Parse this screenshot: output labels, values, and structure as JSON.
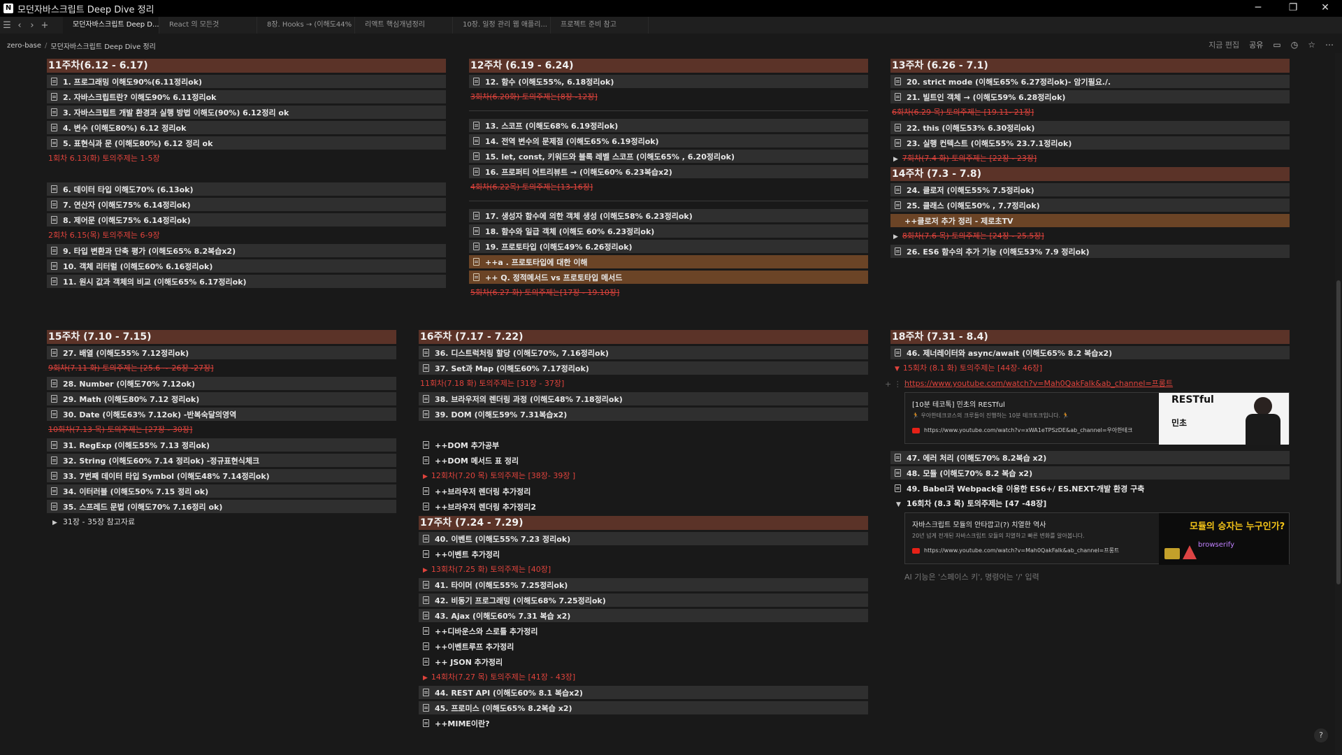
{
  "app": {
    "title": "모던자바스크립트 Deep Dive 정리",
    "icon": "N",
    "controls": {
      "minimize": "─",
      "restore": "❐",
      "close": "✕"
    }
  },
  "tabs": [
    "모던자바스크립트 Deep D...",
    "React 의 모든것",
    "8장. Hooks → (이해도44% ...",
    "리액트 핵심개념정리",
    "10장. 일정 관리 웹 애플리...",
    "프로젝트 준비 참고"
  ],
  "nav": {
    "menu": "☰",
    "back": "‹",
    "forward": "›",
    "new_tab": "+"
  },
  "breadcrumb": {
    "root": "zero-base",
    "sep": "/",
    "current": "모던자바스크립트 Deep Dive 정리"
  },
  "topright": {
    "edited": "지금 편집",
    "share": "공유"
  },
  "col11": {
    "title": "11주차(6.12 - 6.17)",
    "i1": "1. 프로그래밍 이해도90%(6.11정리ok)",
    "i2": "2. 자바스크립트란? 이해도90% 6.11정리ok",
    "i3": "3. 자바스크립트 개발 환경과 실행 방법 이해도(90%) 6.12정리 ok",
    "i4": "4. 변수 (이해도80%) 6.12 정리ok",
    "i5": "5. 표현식과 문 (이해도80%) 6.12 정리 ok",
    "r1": "1회차 6.13(화) 토의주제는 1-5장",
    "i6": "6. 데이터 타입 이해도70% (6.13ok)",
    "i7": "7. 연산자 (이해도75% 6.14정리ok)",
    "i8": "8. 제어문 (이해도75% 6.14정리ok)",
    "r2": "2회차 6.15(목) 토의주제는 6-9장",
    "i9": "9. 타입 변환과 단축 평가 (이해도65% 8.2복습x2)",
    "i10": "10. 객체 리터럴 (이해도60% 6.16정리ok)",
    "i11": "11. 원시 값과 객체의 비교 (이해도65% 6.17정리ok)"
  },
  "col12": {
    "title": "12주차 (6.19 - 6.24)",
    "i12": "12. 함수 (이해도55%, 6.18정리ok)",
    "r3": "3회차(6.20화) 토의주제는[8장 -12장]",
    "i13": "13. 스코프 (이해도68% 6.19정리ok)",
    "i14": "14. 전역 변수의 문제점 (이해도65% 6.19정리ok)",
    "i15": "15. let, const, 키워드와 블록 레벨 스코프 (이해도65% , 6.20정리ok)",
    "i16": "16. 프로퍼티 어트리뷰트 → (이해도60% 6.23복습x2)",
    "r4": "4회차(6.22목) 토의주제는[13-16장]",
    "i17": "17. 생성자 함수에 의한 객체 생성 (이해도58% 6.23정리ok)",
    "i18": "18. 함수와 일급 객체 (이해도 60% 6.23정리ok)",
    "i19": "19. 프로토타입 (이해도49% 6.26정리ok)",
    "o1": "++a . 프로토타입에 대한 이해",
    "o2": "++ Q. 정적메서드 vs 프로토타입 메서드",
    "r5": "5회차(6.27 화) 토의주제는[17장 - 19.10장]"
  },
  "col13": {
    "title": "13주차 (6.26 - 7.1)",
    "i20": "20. strict mode (이해도65% 6.27정리ok)- 암기필요./.",
    "i21": "21. 빌트인 객체 → (이해도59% 6.28정리ok)",
    "r6": "6회차(6.29 목) 토의주제는 [19.11- 21장]",
    "i22": "22. this (이해도53% 6.30정리ok)",
    "i23": "23. 실행 컨텍스트 (이해도55% 23.7.1정리ok)",
    "r7": "7회차(7.4 화) 토의주제는 [22장 - 23장]"
  },
  "col14": {
    "title": "14주차 (7.3 - 7.8)",
    "i24": "24. 클로저 (이해도55% 7.5정리ok)",
    "i25": "25. 클래스 (이해도50% , 7.7정리ok)",
    "o1": "++클로저 추가 정리 - 제로초TV",
    "r8": "8회차(7.6 목) 토의주제는 [24장 - 25.5장]",
    "i26": "26. ES6 함수의 추가 기능 (이해도53% 7.9 정리ok)"
  },
  "col15": {
    "title": "15주차 (7.10 - 7.15)",
    "i27": "27. 배열 (이해도55% 7.12정리ok)",
    "r9": "9회차(7.11 화) 토의주제는 [25.6 ~ 26장 -27장]",
    "i28": "28. Number (이해도70% 7.12ok)",
    "i29": "29. Math (이해도80% 7.12 정리ok)",
    "i30": "30. Date (이해도63% 7.12ok) -반복숙달의영역",
    "r10": "10회차(7.13 목) 토의주제는 [27장 - 30장]",
    "i31": "31. RegExp (이해도55% 7.13 정리ok)",
    "i32": "32. String (이해도60% 7.14 정리ok) -정규표현식체크",
    "i33": "33. 7번째 데이터 타입 Symbol (이해도48% 7.14정리ok)",
    "i34": "34. 이터러블 (이해도50% 7.15 정리 ok)",
    "i35": "35. 스프레드 문법 (이해도70% 7.16정리 ok)",
    "t1": "31장 - 35장 참고자료"
  },
  "col16": {
    "title": "16주차 (7.17 - 7.22)",
    "i36": "36. 디스트럭처링 할당 (이해도70%, 7.16정리ok)",
    "i37": "37. Set과 Map (이해도60% 7.17정리ok)",
    "r11": "11회차(7.18 화) 토의주제는 [31장 - 37장]",
    "i38": "38. 브라우저의 렌더링 과정 (이해도48% 7.18정리ok)",
    "i39": "39. DOM (이해도59% 7.31복습x2)",
    "p1": "++DOM 추가공부",
    "p2": "++DOM 메서드 표 정리",
    "r12": "12회차(7.20 목) 토의주제는 [38장- 39장 ]",
    "p3": "++브라우저 렌더링 추가정리",
    "p4": "++브라우저 렌더링 추가정리2"
  },
  "col17": {
    "title": "17주차 (7.24 - 7.29)",
    "i40": "40. 이벤트 (이해도55% 7.23 정리ok)",
    "p1": "++이벤트 추가정리",
    "r13": "13회차(7.25 화) 토의주제는 [40장]",
    "i41": "41. 타이머 (이해도55% 7.25정리ok)",
    "i42": "42. 비동기 프로그래밍 (이해도68% 7.25정리ok)",
    "i43": "43. Ajax (이해도60% 7.31 복습 x2)",
    "p2": "++디바운스와 스로틀 추가정리",
    "p3": "++이벤트루프 추가정리",
    "p4": "++ JSON 추가정리",
    "r14": "14회차(7.27 목) 토의주제는 [41장 - 43장]",
    "i44": "44. REST API (이해도60% 8.1 복습x2)",
    "i45": "45. 프로미스 (이해도65% 8.2복습 x2)",
    "p5": "++MIME이란?"
  },
  "col18": {
    "title": "18주차 (7.31 - 8.4)",
    "i46": "46. 제너레이터와 async/await (이해도65% 8.2 복습x2)",
    "r15": "15회차 (8.1 화) 토의주제는 [44장- 46장]",
    "link1": "https://www.youtube.com/watch?v=Mah0QakFaIk&ab_channel=프롱트",
    "bm1": {
      "title": "[10분 테코톡] 민초의 RESTful",
      "desc": "🏃 우아한테크코스의 크루들이 진행하는 10분 테크토크입니다. 🏃",
      "url": "https://www.youtube.com/watch?v=xWA1eTPSzDE&ab_channel=우아한테크",
      "thumb_a": "RESTful",
      "thumb_b": "민초"
    },
    "i47": "47. 에러 처리 (이해도70% 8.2복습 x2)",
    "i48": "48. 모듈 (이해도70% 8.2 복습 x2)",
    "i49": "49. Babel과 Webpack을 이용한 ES6+/ ES.NEXT-개발 환경 구축",
    "r16": "16회차 (8.3 목) 토의주제는 [47 -48장]",
    "bm2": {
      "title": "자바스크립트 모듈의 안타깝고(?) 치열한 역사",
      "desc": "20년 넘게 전개된 자바스크립트 모듈의 치열하고 빠른 변화를 알아봅니다.",
      "url": "https://www.youtube.com/watch?v=Mah0QakFaIk&ab_channel=프롱트",
      "thumb_a": "모듈의 승자는 누구인가?",
      "thumb_b": "browserify"
    },
    "ai_hint": "AI 기능은 '스페이스 키', 명령어는 '/' 입력"
  },
  "help": "?",
  "colors": {
    "week_header": "#5b3328",
    "item_bg": "#2f2f2f",
    "accent_red": "#e0433c",
    "orange_item": "#6b4426"
  }
}
